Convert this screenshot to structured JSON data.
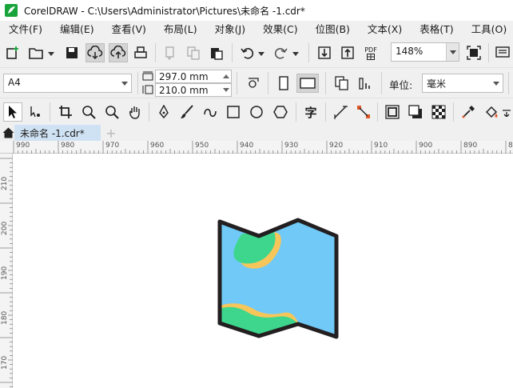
{
  "app": {
    "title": "CorelDRAW - C:\\Users\\Administrator\\Pictures\\未命名 -1.cdr*"
  },
  "menu": [
    "文件(F)",
    "编辑(E)",
    "查看(V)",
    "布局(L)",
    "对象(J)",
    "效果(C)",
    "位图(B)",
    "文本(X)",
    "表格(T)",
    "工具(O)"
  ],
  "standard_toolbar": {
    "zoom_value": "148%",
    "pdf_label": "PDF"
  },
  "property_bar": {
    "page_size": "A4",
    "width": "297.0 mm",
    "height": "210.0 mm",
    "units_label": "单位:",
    "units_value": "毫米"
  },
  "toolbox": {
    "text_tool_glyph": "字"
  },
  "document_tab": {
    "label": "未命名 -1.cdr*",
    "add_label": "+"
  },
  "ruler": {
    "horizontal": [
      "990",
      "980",
      "970",
      "960",
      "950",
      "940",
      "930",
      "920",
      "910",
      "900",
      "890",
      "8"
    ],
    "vertical": [
      "210",
      "200",
      "190",
      "180",
      "170"
    ]
  },
  "drawing": {
    "name": "folded-map-illustration",
    "colors": {
      "outline": "#231f20",
      "water": "#70c9f7",
      "land": "#3dd68c",
      "sand": "#f6c65b"
    }
  },
  "colors": {
    "app_icon": "#18a33b",
    "tab_active": "#cfe2f3",
    "chrome": "#f0f0f0"
  }
}
